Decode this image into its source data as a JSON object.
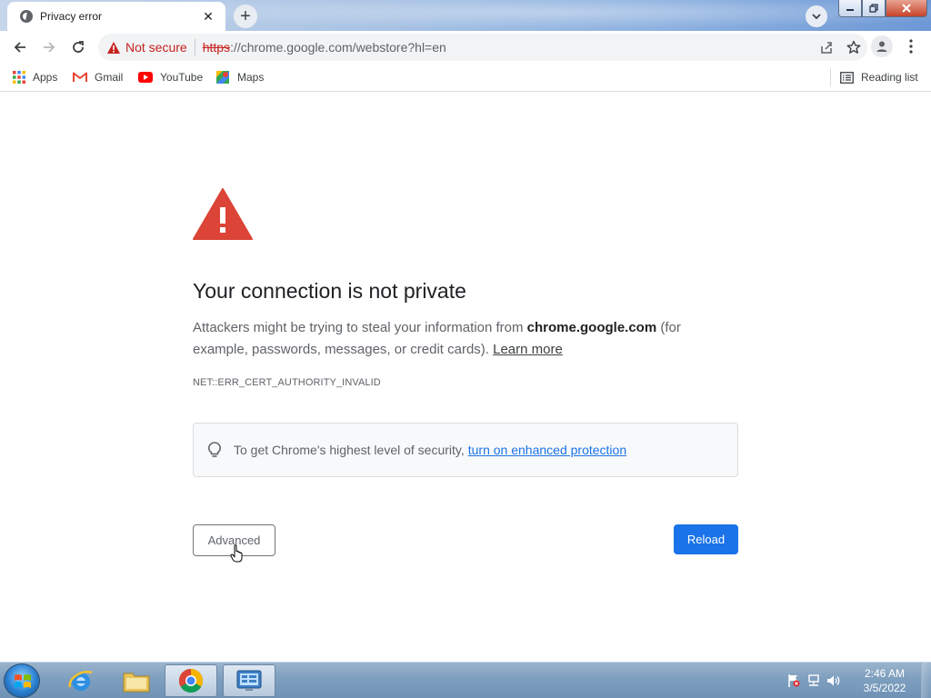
{
  "tab": {
    "title": "Privacy error",
    "close": "✕"
  },
  "new_tab": "+",
  "omnibox": {
    "security_label": "Not secure",
    "url_scheme": "https",
    "url_rest": "://chrome.google.com/webstore?hl=en"
  },
  "bookmarks": [
    {
      "label": "Apps",
      "icon": "apps-grid-icon"
    },
    {
      "label": "Gmail",
      "icon": "gmail-icon"
    },
    {
      "label": "YouTube",
      "icon": "youtube-icon"
    },
    {
      "label": "Maps",
      "icon": "maps-icon"
    }
  ],
  "reading_list": "Reading list",
  "page": {
    "heading": "Your connection is not private",
    "explain_pre": "Attackers might be trying to steal your information from ",
    "explain_domain": "chrome.google.com",
    "explain_post": " (for example, passwords, messages, or credit cards). ",
    "learn_more": "Learn more",
    "error_code": "NET::ERR_CERT_AUTHORITY_INVALID",
    "tip_text": "To get Chrome's highest level of security,",
    "tip_link": "turn on enhanced protection",
    "advanced_label": "Advanced",
    "reload_label": "Reload"
  },
  "taskbar": {
    "time": "2:46 AM",
    "date": "3/5/2022"
  },
  "colors": {
    "danger": "#c5221f",
    "primary": "#1a73e8",
    "warning_red": "#db4437"
  }
}
